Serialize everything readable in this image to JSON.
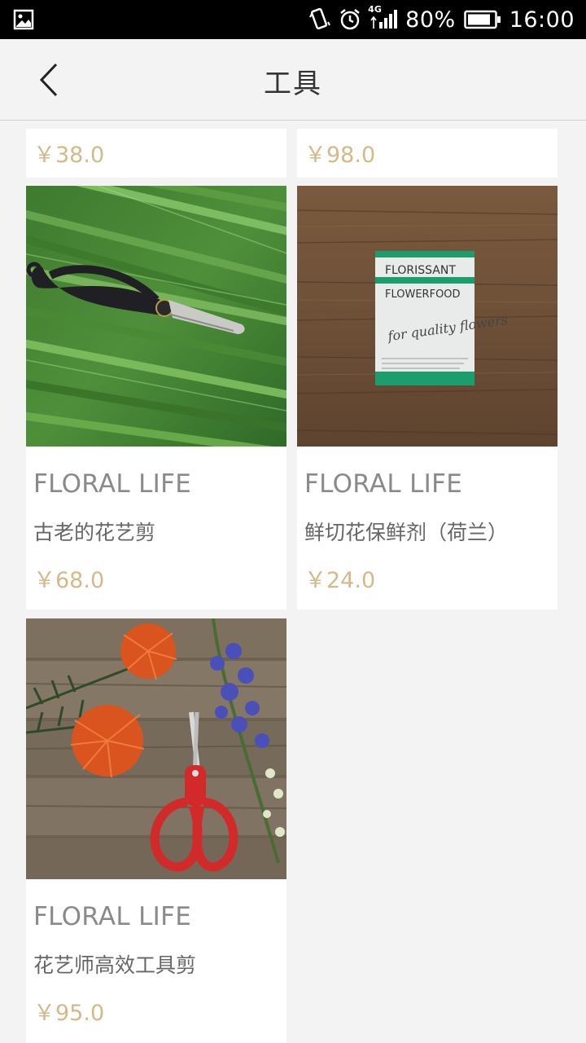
{
  "status_bar": {
    "network_tag": "4G",
    "battery_percent": "80%",
    "time": "16:00"
  },
  "header": {
    "title": "工具",
    "back_icon": "chevron-left-icon"
  },
  "products_partial": [
    {
      "price": "￥38.0"
    },
    {
      "price": "￥98.0"
    }
  ],
  "products": [
    {
      "brand": "FLORAL LIFE",
      "name": "古老的花艺剪",
      "price": "￥68.0",
      "image": "floral-scissors-on-leaves"
    },
    {
      "brand": "FLORAL LIFE",
      "name": "鲜切花保鲜剂（荷兰）",
      "price": "￥24.0",
      "image": "flower-food-sachet",
      "image_text": {
        "brand": "FLORISSANT",
        "product": "FLOWERFOOD",
        "script": "for quality flowers"
      }
    },
    {
      "brand": "FLORAL LIFE",
      "name": "花艺师高效工具剪",
      "price": "￥95.0",
      "image": "red-scissors-with-flowers"
    }
  ],
  "colors": {
    "price": "#d4b98a",
    "background": "#f3f3f3",
    "status_bar": "#000000"
  }
}
